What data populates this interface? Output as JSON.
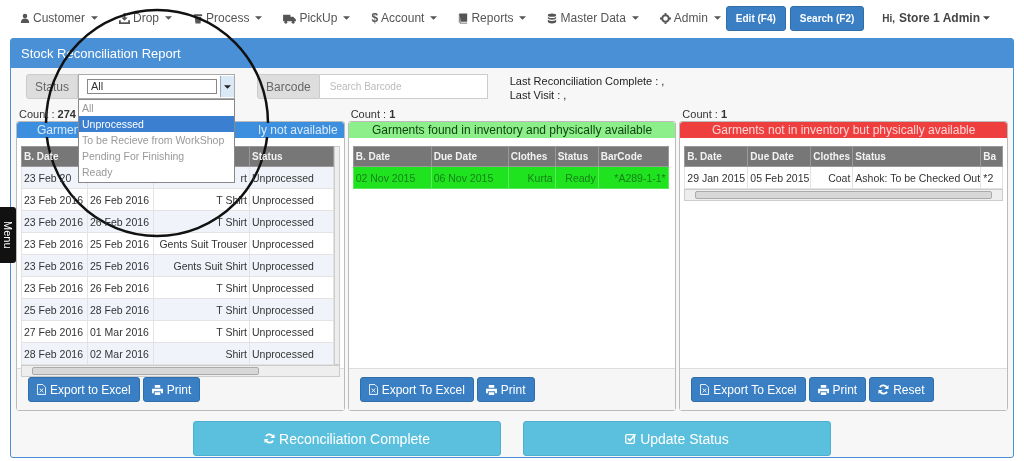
{
  "nav": {
    "items": [
      {
        "label": "Customer",
        "kind": "user"
      },
      {
        "label": "Drop",
        "kind": "download"
      },
      {
        "label": "Process",
        "kind": "bin"
      },
      {
        "label": "PickUp",
        "kind": "truck"
      },
      {
        "label": "Account",
        "kind": "glyph",
        "glyph": "$"
      },
      {
        "label": "Reports",
        "kind": "book"
      },
      {
        "label": "Master Data",
        "kind": "database"
      },
      {
        "label": "Admin",
        "kind": "gear"
      }
    ],
    "buttons": [
      "Edit (F4)",
      "Search (F2)"
    ],
    "user": {
      "greeting": "Hi,",
      "name": "Store 1 Admin"
    }
  },
  "side_tab": {
    "label": "Menu"
  },
  "panel": {
    "title": "Stock Reconciliation Report"
  },
  "filters": {
    "status": {
      "label": "Status",
      "value": "All",
      "expanded": true,
      "options": [
        {
          "label": "All",
          "highlighted": false
        },
        {
          "label": "Unprocessed",
          "highlighted": true
        },
        {
          "label": "To be Recieve from WorkShop",
          "highlighted": false
        },
        {
          "label": "Pending For Finishing",
          "highlighted": false
        },
        {
          "label": "Ready",
          "highlighted": false
        }
      ]
    },
    "barcode": {
      "label": "Barcode",
      "placeholder": "Search Barcode"
    },
    "info": [
      "Last Reconciliation Complete : ,",
      "Last Visit : ,"
    ]
  },
  "sections": [
    {
      "kind": "missing",
      "count_label": "Count :",
      "count": "274",
      "title_parts": [
        "Garmen",
        "ly not available"
      ],
      "columns": [
        "B. Date",
        null,
        null,
        "Status"
      ],
      "rows": [
        [
          "23 Feb 20",
          null,
          "rt",
          "Unprocessed"
        ],
        [
          "23 Feb 2016",
          "26 Feb 2016",
          "T Shirt",
          "Unprocessed"
        ],
        [
          "23 Feb 2016",
          "26 Feb 2016",
          "T Shirt",
          "Unprocessed"
        ],
        [
          "23 Feb 2016",
          "25 Feb 2016",
          "Gents Suit Trouser",
          "Unprocessed"
        ],
        [
          "23 Feb 2016",
          "25 Feb 2016",
          "Gents Suit Shirt",
          "Unprocessed"
        ],
        [
          "23 Feb 2016",
          "26 Feb 2016",
          "T Shirt",
          "Unprocessed"
        ],
        [
          "25 Feb 2016",
          "28 Feb 2016",
          "T Shirt",
          "Unprocessed"
        ],
        [
          "27 Feb 2016",
          "01 Mar 2016",
          "T Shirt",
          "Unprocessed"
        ],
        [
          "28 Feb 2016",
          "02 Mar 2016",
          "Shirt",
          "Unprocessed"
        ]
      ],
      "buttons": [
        {
          "label": "Export to Excel",
          "kind": "excel"
        },
        {
          "label": "Print",
          "kind": "print"
        }
      ]
    },
    {
      "kind": "found",
      "count_label": "Count :",
      "count": "1",
      "title_parts": [
        "Garments found in inventory and physically available"
      ],
      "columns": [
        "B. Date",
        "Due Date",
        "Clothes",
        "Status",
        "BarCode"
      ],
      "rows": [
        [
          "02 Nov 2015",
          "06 Nov 2015",
          "Kurta",
          "Ready",
          "*A289-1-1*"
        ]
      ],
      "buttons": [
        {
          "label": "Export To Excel",
          "kind": "excel"
        },
        {
          "label": "Print",
          "kind": "print"
        }
      ]
    },
    {
      "kind": "extra",
      "count_label": "Count :",
      "count": "1",
      "title_parts": [
        "Garments not in inventory but physically available"
      ],
      "columns": [
        "B. Date",
        "Due Date",
        "Clothes",
        "Status",
        "Ba"
      ],
      "rows": [
        [
          "29 Jan 2015",
          "05 Feb 2015",
          "Coat",
          "Ashok: To be Checked Out",
          "*2"
        ]
      ],
      "buttons": [
        {
          "label": "Export To Excel",
          "kind": "excel"
        },
        {
          "label": "Print",
          "kind": "print"
        },
        {
          "label": "Reset",
          "kind": "refresh"
        }
      ]
    }
  ],
  "actions": [
    {
      "label": "Reconciliation Complete",
      "kind": "refresh"
    },
    {
      "label": "Update Status",
      "kind": "check"
    }
  ],
  "annotation": {
    "circle": true
  }
}
